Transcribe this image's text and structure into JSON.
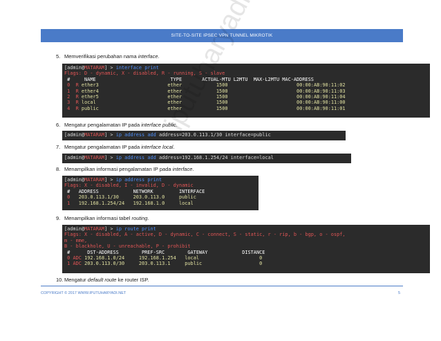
{
  "header": {
    "title": "SITE-TO-SITE IPSEC VPN TUNNEL MIKROTIK"
  },
  "items": [
    {
      "num": "5.",
      "text": "Memverifikasi perubahan nama ",
      "em": "interface",
      "after": "."
    },
    {
      "num": "6.",
      "text": "Mengatur pengalamatan IP pada ",
      "em": "interface public",
      "after": "."
    },
    {
      "num": "7.",
      "text": "Mengatur pengalamatan IP pada ",
      "em": "interface local",
      "after": "."
    },
    {
      "num": "8.",
      "text": "Menampilkan informasi pengalamatan IP pada ",
      "em": "interface",
      "after": "."
    },
    {
      "num": "9.",
      "text": "Menampilkan informasi tabel ",
      "em": "routing",
      "after": "."
    },
    {
      "num": "10.",
      "text": "Mengatur ",
      "em": "default route",
      "after": " ke router ISP."
    }
  ],
  "terminals": {
    "t1": {
      "prompt_open": "[",
      "user": "admin",
      "at": "@",
      "host": "MATARAM",
      "prompt_close": "] > ",
      "command": "interface print",
      "flags": "Flags: D - dynamic, X - disabled, R - running, S - slave",
      "header": " #     NAME                          TYPE       ACTUAL-MTU L2MTU  MAX-L2MTU MAC-ADDRESS",
      "rows": [
        {
          "idx": " 0",
          "flag": "  R ",
          "rest": "ether3                        ether            1500                        00:00:AB:90:11:02"
        },
        {
          "idx": " 1",
          "flag": "  R ",
          "rest": "ether4                        ether            1500                        00:00:AB:90:11:03"
        },
        {
          "idx": " 2",
          "flag": "  R ",
          "rest": "ether5                        ether            1500                        00:00:AB:90:11:04"
        },
        {
          "idx": " 3",
          "flag": "  R ",
          "rest": "local                         ether            1500                        00:00:AB:90:11:00"
        },
        {
          "idx": " 4",
          "flag": "  R ",
          "rest": "public                        ether            1500                        00:00:AB:90:11:01"
        }
      ]
    },
    "t2": {
      "prompt_open": "[",
      "user": "admin",
      "at": "@",
      "host": "MATARAM",
      "prompt_close": "] > ",
      "command": "ip address add ",
      "args": "address=203.0.113.1/30 interface=public"
    },
    "t3": {
      "prompt_open": "[",
      "user": "admin",
      "at": "@",
      "host": "MATARAM",
      "prompt_close": "] > ",
      "command": "ip address add ",
      "args": "address=192.168.1.254/24 interface=local"
    },
    "t4": {
      "prompt_open": "[",
      "user": "admin",
      "at": "@",
      "host": "MATARAM",
      "prompt_close": "] > ",
      "command": "ip address print",
      "flags": "Flags: X - disabled, I - invalid, D - dynamic",
      "header": " #   ADDRESS            NETWORK         INTERFACE",
      "rows": [
        {
          "idx": " 0",
          "rest": "   203.0.113.1/30     203.0.113.0     public"
        },
        {
          "idx": " 1",
          "rest": "   192.168.1.254/24   192.168.1.0     local"
        }
      ]
    },
    "t5": {
      "prompt_open": "[",
      "user": "admin",
      "at": "@",
      "host": "MATARAM",
      "prompt_close": "] > ",
      "command": "ip route print",
      "flags1": "Flags: X - disabled, A - active, D - dynamic, C - connect, S - static, r - rip, b - bgp, o - ospf,",
      "flags2": "m - mme,",
      "flags3": "B - blackhole, U - unreachable, P - prohibit",
      "header": " #      DST-ADDRESS        PREF-SRC        GATEWAY            DISTANCE",
      "rows": [
        {
          "idx": " 0",
          "flag": " ADC ",
          "rest": "192.168.1.0/24     192.168.1.254   local                     0"
        },
        {
          "idx": " 1",
          "flag": " ADC ",
          "rest": "203.0.113.0/30     203.0.113.1     public                    0"
        }
      ]
    }
  },
  "footer": {
    "left": "COPYRIGHT © 2017 WWW.IPUTUHARYADI.NET",
    "right": "5"
  },
  "watermark": "iputuharyadi.net",
  "colors": {
    "accent": "#4a7bc8",
    "terminal_bg": "#2b2b2b",
    "prompt_host": "#e05555",
    "command": "#4f8ef7"
  }
}
